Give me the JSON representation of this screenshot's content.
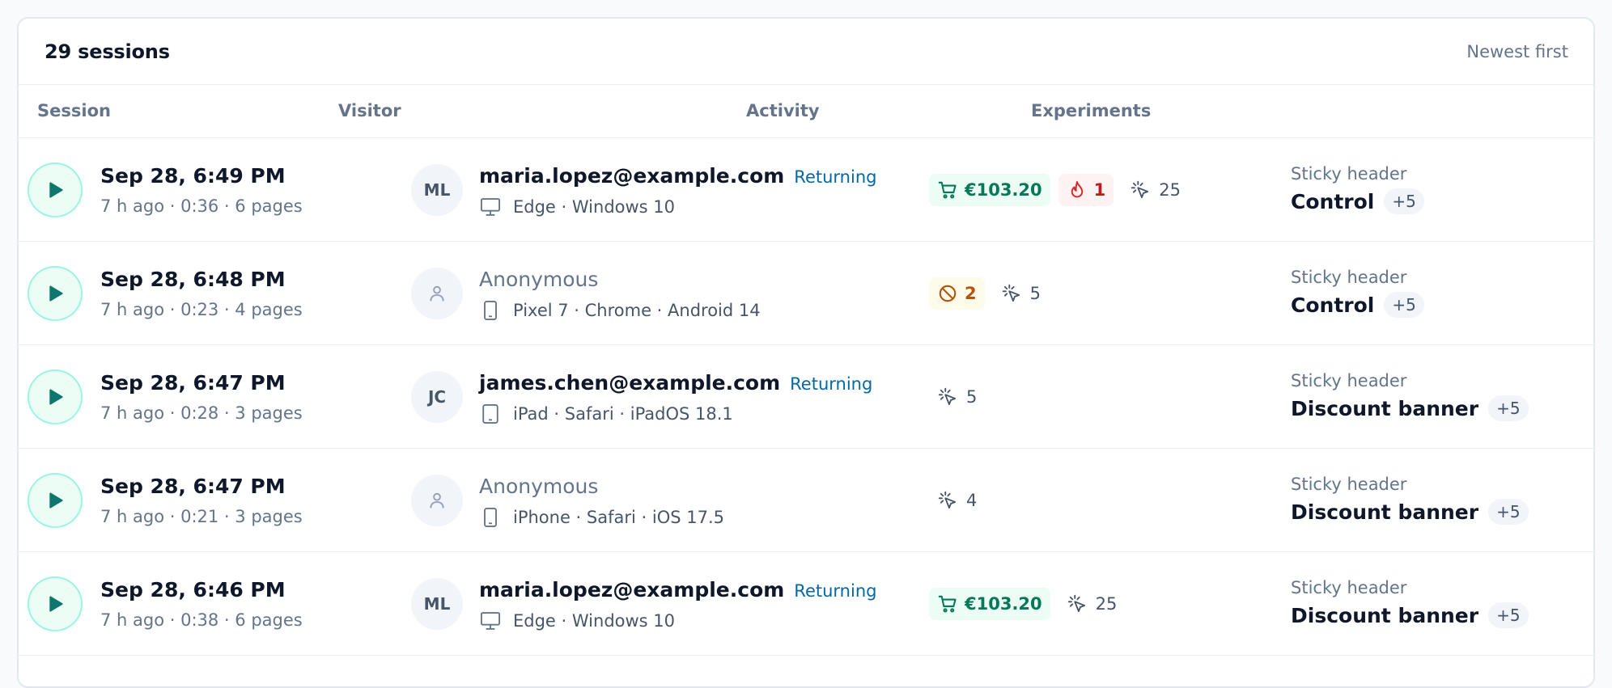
{
  "header": {
    "count": "29 sessions",
    "sort": "Newest first"
  },
  "columns": {
    "session": "Session",
    "visitor": "Visitor",
    "activity": "Activity",
    "experiments": "Experiments"
  },
  "colors": {
    "accent": "#0f766e",
    "returning": "#0369a1",
    "cart": "#047857",
    "rage": "#b91c1c",
    "blocked": "#b45309"
  },
  "rows": [
    {
      "title": "Sep 28, 6:49 PM",
      "meta": "7 h ago · 0:36 · 6 pages",
      "avatar": "ML",
      "visitor": "maria.lopez@example.com",
      "returning": "Returning",
      "device_icon": "desktop-icon",
      "device": "Edge · Windows 10",
      "cart": "€103.20",
      "rage": "1",
      "clicks": "25",
      "experiment": "Sticky header",
      "variant": "Control",
      "more": "+5"
    },
    {
      "title": "Sep 28, 6:48 PM",
      "meta": "7 h ago · 0:23 · 4 pages",
      "avatar_icon": "user-icon",
      "visitor": "Anonymous",
      "device_icon": "phone-icon",
      "device": "Pixel 7 · Chrome · Android 14",
      "blocked": "2",
      "clicks": "5",
      "experiment": "Sticky header",
      "variant": "Control",
      "more": "+5"
    },
    {
      "title": "Sep 28, 6:47 PM",
      "meta": "7 h ago · 0:28 · 3 pages",
      "avatar": "JC",
      "visitor": "james.chen@example.com",
      "returning": "Returning",
      "device_icon": "tablet-icon",
      "device": "iPad · Safari · iPadOS 18.1",
      "clicks": "5",
      "experiment": "Sticky header",
      "variant": "Discount banner",
      "more": "+5"
    },
    {
      "title": "Sep 28, 6:47 PM",
      "meta": "7 h ago · 0:21 · 3 pages",
      "avatar_icon": "user-icon",
      "visitor": "Anonymous",
      "device_icon": "phone-icon",
      "device": "iPhone · Safari · iOS 17.5",
      "clicks": "4",
      "experiment": "Sticky header",
      "variant": "Discount banner",
      "more": "+5"
    },
    {
      "title": "Sep 28, 6:46 PM",
      "meta": "7 h ago · 0:38 · 6 pages",
      "avatar": "ML",
      "visitor": "maria.lopez@example.com",
      "returning": "Returning",
      "device_icon": "desktop-icon",
      "device": "Edge · Windows 10",
      "cart": "€103.20",
      "clicks": "25",
      "experiment": "Sticky header",
      "variant": "Discount banner",
      "more": "+5"
    }
  ]
}
